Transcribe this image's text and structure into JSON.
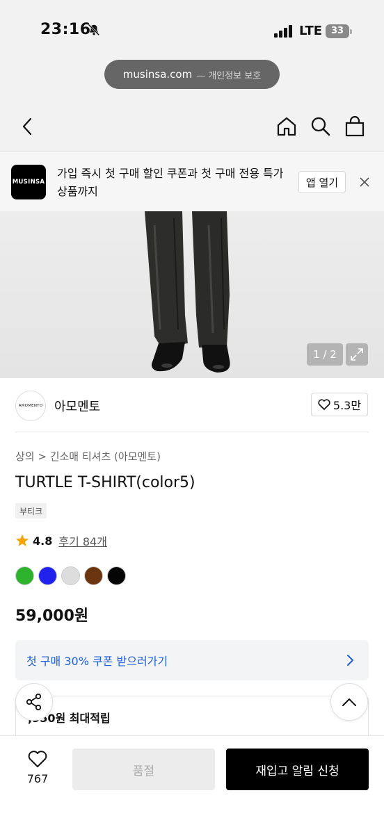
{
  "status_bar": {
    "time": "23:16",
    "network": "LTE",
    "battery": "33"
  },
  "url_bar": {
    "domain": "musinsa.com",
    "privacy": "— 개인정보 보호"
  },
  "nav": {
    "back_icon": "chevron-left-icon",
    "home_icon": "home-icon",
    "search_icon": "search-icon",
    "bag_icon": "shopping-bag-icon"
  },
  "app_banner": {
    "logo_text": "MUSINSA",
    "message": "가입 즉시 첫 구매 할인 쿠폰과 첫 구매 전용 특가 상품까지",
    "open_label": "앱 열기",
    "close_icon": "close-icon"
  },
  "gallery": {
    "counter": "1 / 2",
    "expand_icon": "expand-icon"
  },
  "brand": {
    "logo_text": "AMOMENTO",
    "name": "아모멘토",
    "likes": "5.3만"
  },
  "product": {
    "breadcrumb": "상의 > 긴소매 티셔츠 (아모멘토)",
    "title": "TURTLE T-SHIRT(color5)",
    "tag": "부티크",
    "rating": "4.8",
    "reviews": "후기 84개",
    "colors": [
      "#2db22d",
      "#2222ee",
      "#dddddd",
      "#6b3510",
      "#050505"
    ],
    "price": "59,000원"
  },
  "coupon": {
    "text": "첫 구매 30% 쿠폰 받으러가기"
  },
  "points": {
    "text": ",950원 최대적립"
  },
  "bottom_bar": {
    "like_count": "767",
    "soldout_label": "품절",
    "restock_label": "재입고 알림 신청"
  }
}
